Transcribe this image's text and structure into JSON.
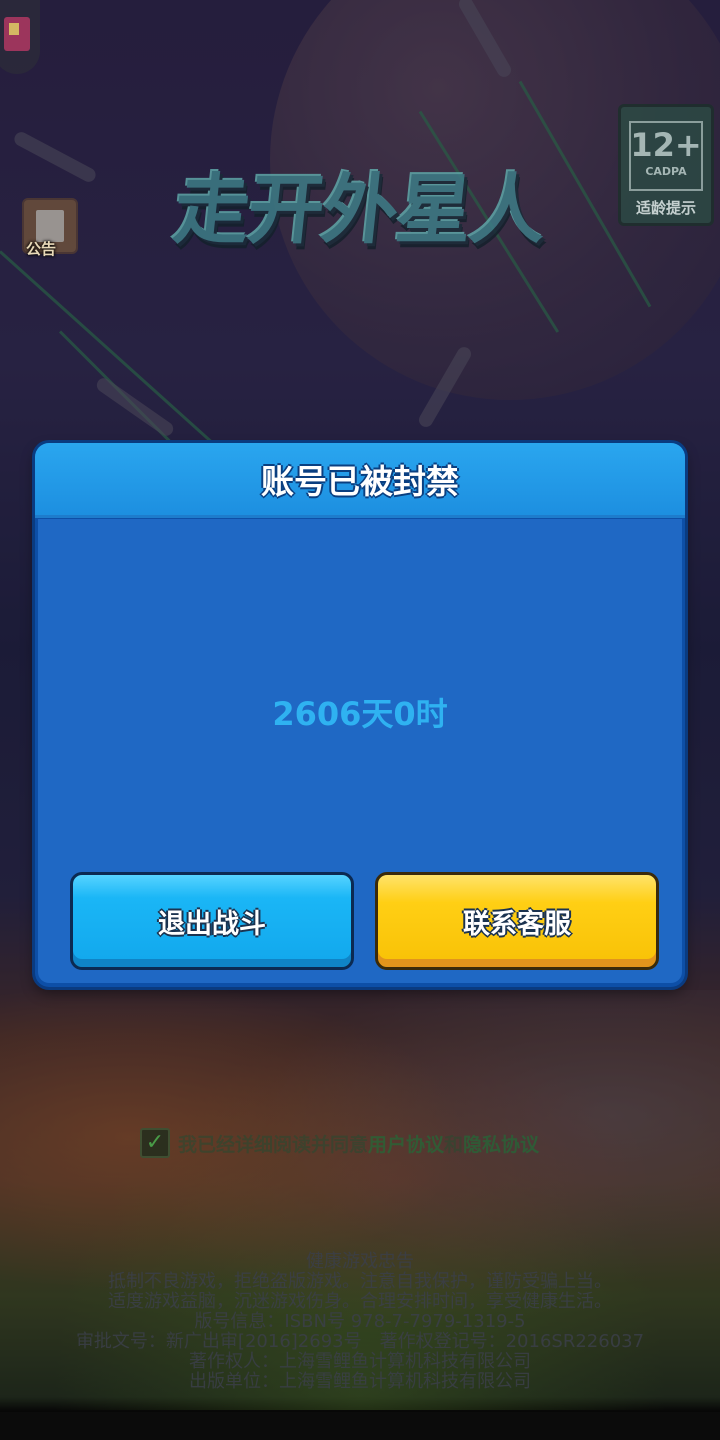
{
  "logo": {
    "text": "走开外星人"
  },
  "notice": {
    "label": "公告",
    "icon": "clipboard-icon"
  },
  "age_badge": {
    "rating": "12+",
    "org": "CADPA",
    "tip": "适龄提示"
  },
  "dialog": {
    "title": "账号已被封禁",
    "duration": "2606天0时",
    "exit_button": "退出战斗",
    "contact_button": "联系客服"
  },
  "agreement": {
    "checked": true,
    "prefix": "我已经详细阅读并同意",
    "user_agreement": "用户协议",
    "and": "和",
    "privacy_agreement": "隐私协议"
  },
  "footer": {
    "lines": [
      "健康游戏忠告",
      "抵制不良游戏，拒绝盗版游戏。注意自我保护，谨防受骗上当。",
      "适度游戏益脑，沉迷游戏伤身。合理安排时间，享受健康生活。",
      "版号信息：ISBN号 978-7-7979-1319-5",
      "审批文号：新广出审[2016]2693号　著作权登记号：2016SR226037",
      "著作权人：上海雪鲤鱼计算机科技有限公司",
      "出版单位：上海雪鲤鱼计算机科技有限公司"
    ]
  },
  "colors": {
    "dialog_bg": "#1f68c4",
    "header": "#1d8fe0",
    "duration_text": "#2fb2f1",
    "exit_button": "#12a7ec",
    "contact_button": "#f8c106"
  }
}
